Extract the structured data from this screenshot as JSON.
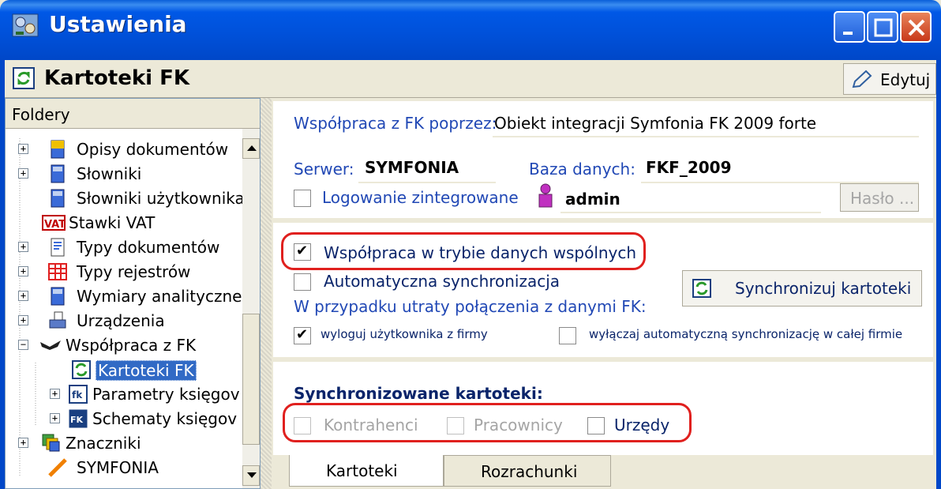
{
  "window": {
    "title": "Ustawienia"
  },
  "header": {
    "title": "Kartoteki FK",
    "edit_label": "Edytuj"
  },
  "sidebar": {
    "header": "Foldery",
    "items": [
      {
        "label": "Opisy dokumentów",
        "icon": "document-description-icon",
        "expanded": false
      },
      {
        "label": "Słowniki",
        "icon": "dictionary-icon",
        "expanded": false
      },
      {
        "label": "Słowniki użytkownika",
        "icon": "user-dictionary-icon",
        "expanded": null
      },
      {
        "label": "Stawki VAT",
        "icon": "vat-icon",
        "expanded": null
      },
      {
        "label": "Typy dokumentów",
        "icon": "document-types-icon",
        "expanded": false
      },
      {
        "label": "Typy rejestrów",
        "icon": "register-types-icon",
        "expanded": false
      },
      {
        "label": "Wymiary analityczne",
        "icon": "analytics-icon",
        "expanded": false
      },
      {
        "label": "Urządzenia",
        "icon": "devices-icon",
        "expanded": false
      },
      {
        "label": "Współpraca z FK",
        "icon": "handshake-icon",
        "expanded": true
      },
      {
        "label": "Kartoteki FK",
        "icon": "sync-icon",
        "selected": true
      },
      {
        "label": "Parametry księgov",
        "icon": "fk-params-icon",
        "expanded": false
      },
      {
        "label": "Schematy księgov",
        "icon": "fk-schemes-icon",
        "expanded": false
      },
      {
        "label": "Znaczniki",
        "icon": "tags-icon",
        "expanded": false
      },
      {
        "label": "SYMFONIA",
        "icon": "symfonia-icon",
        "expanded": null
      }
    ]
  },
  "connection": {
    "via_label": "Współpraca z FK poprzez:",
    "via_value": "Obiekt integracji Symfonia FK 2009 forte",
    "server_label": "Serwer:",
    "server_value": "SYMFONIA",
    "db_label": "Baza danych:",
    "db_value": "FKF_2009",
    "integrated_login_label": "Logowanie zintegrowane",
    "integrated_login_checked": false,
    "user_value": "admin",
    "password_button": "Hasło ..."
  },
  "options": {
    "shared_mode_label": "Współpraca w trybie danych wspólnych",
    "shared_mode_checked": true,
    "auto_sync_label": "Automatyczna synchronizacja",
    "auto_sync_checked": false,
    "sync_button": "Synchronizuj kartoteki",
    "lost_conn_label": "W przypadku utraty połączenia z danymi FK:",
    "logout_label": "wyloguj użytkownika z firmy",
    "logout_checked": true,
    "disable_sync_label": "wyłączaj automatyczną synchronizację w całej firmie",
    "disable_sync_checked": false
  },
  "synced": {
    "heading": "Synchronizowane kartoteki:",
    "items": [
      {
        "label": "Kontrahenci",
        "checked": false,
        "enabled": false
      },
      {
        "label": "Pracownicy",
        "checked": false,
        "enabled": false
      },
      {
        "label": "Urzędy",
        "checked": false,
        "enabled": true
      }
    ]
  },
  "tabs": [
    {
      "label": "Kartoteki",
      "active": true
    },
    {
      "label": "Rozrachunki",
      "active": false
    }
  ],
  "colors": {
    "titlebar": "#0050d8",
    "selection": "#316ac5",
    "highlight": "#e0201e",
    "link_text": "#2148b5"
  }
}
